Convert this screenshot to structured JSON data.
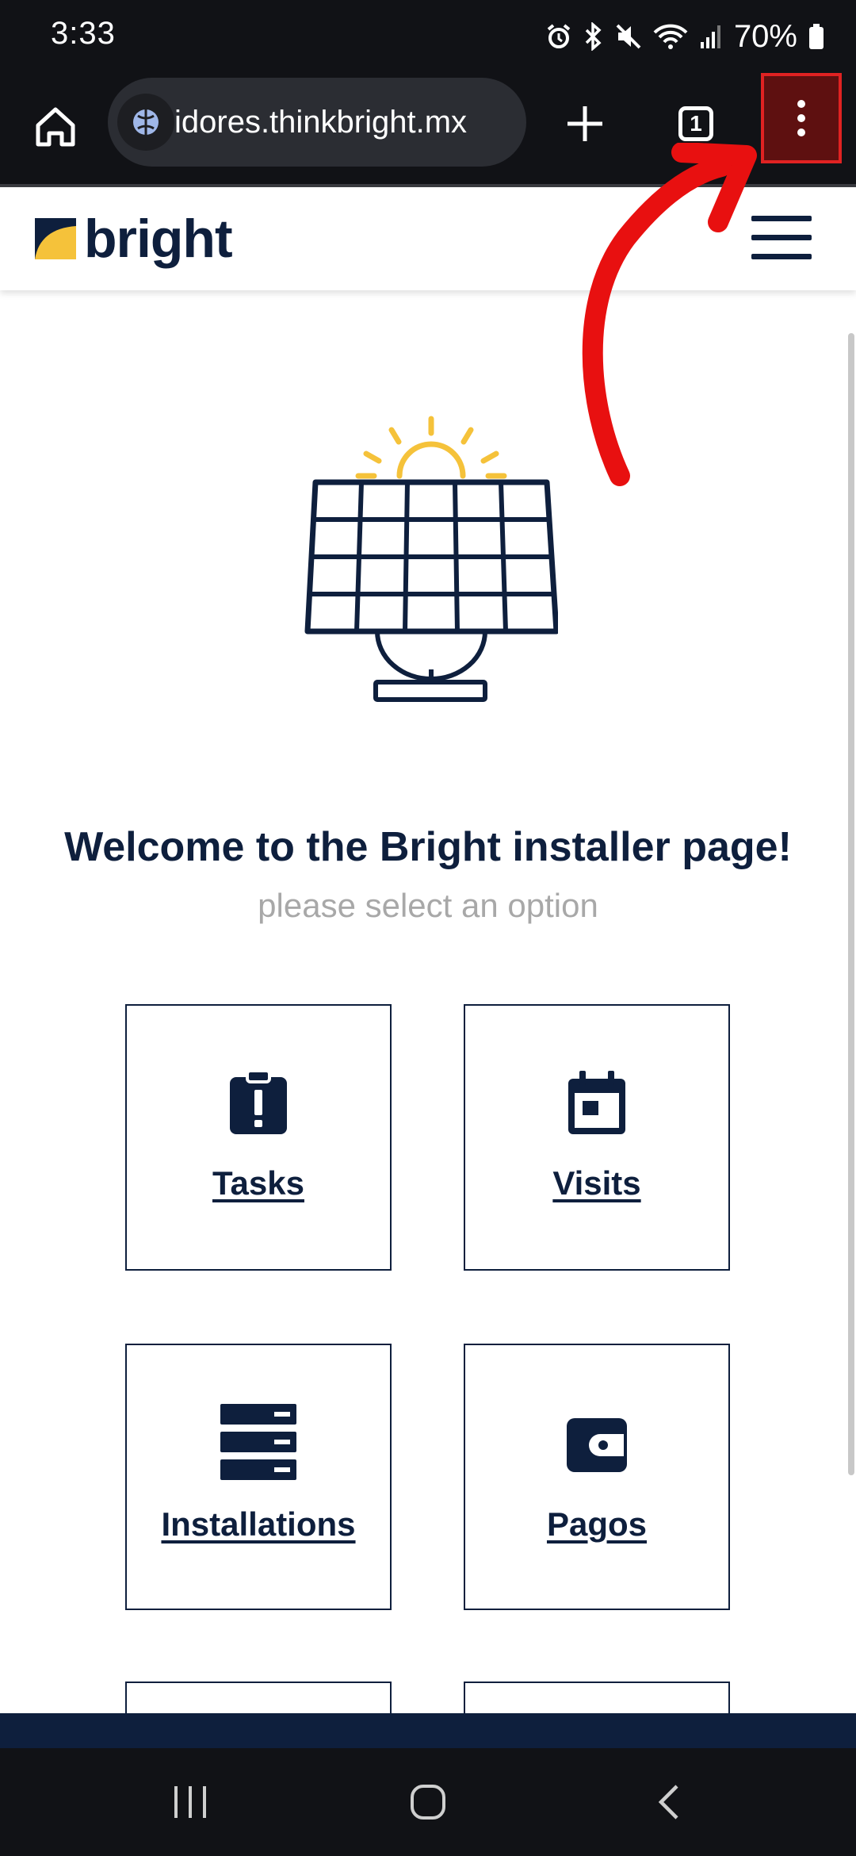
{
  "status_bar": {
    "time": "3:33",
    "battery": "70%",
    "icons": [
      "alarm-icon",
      "bluetooth-icon",
      "mute-icon",
      "wifi-icon",
      "signal-icon",
      "battery-icon"
    ]
  },
  "browser": {
    "url": "idores.thinkbright.mx",
    "tab_count": "1",
    "icons": [
      "home-icon",
      "site-settings-icon",
      "plus-icon",
      "tabs-icon",
      "more-vert-icon"
    ]
  },
  "site": {
    "logo_text": "bright",
    "welcome_title": "Welcome to the Bright installer page!",
    "subtitle": "please select an option",
    "cards": [
      {
        "label": "Tasks",
        "icon": "clipboard-alert-icon"
      },
      {
        "label": "Visits",
        "icon": "calendar-icon"
      },
      {
        "label": "Installations",
        "icon": "server-list-icon"
      },
      {
        "label": "Pagos",
        "icon": "wallet-icon"
      }
    ]
  },
  "colors": {
    "navy": "#0e1f3d",
    "sun_yellow": "#f5c23a",
    "annotation_red": "#e81010",
    "chrome_dark": "#111216"
  }
}
